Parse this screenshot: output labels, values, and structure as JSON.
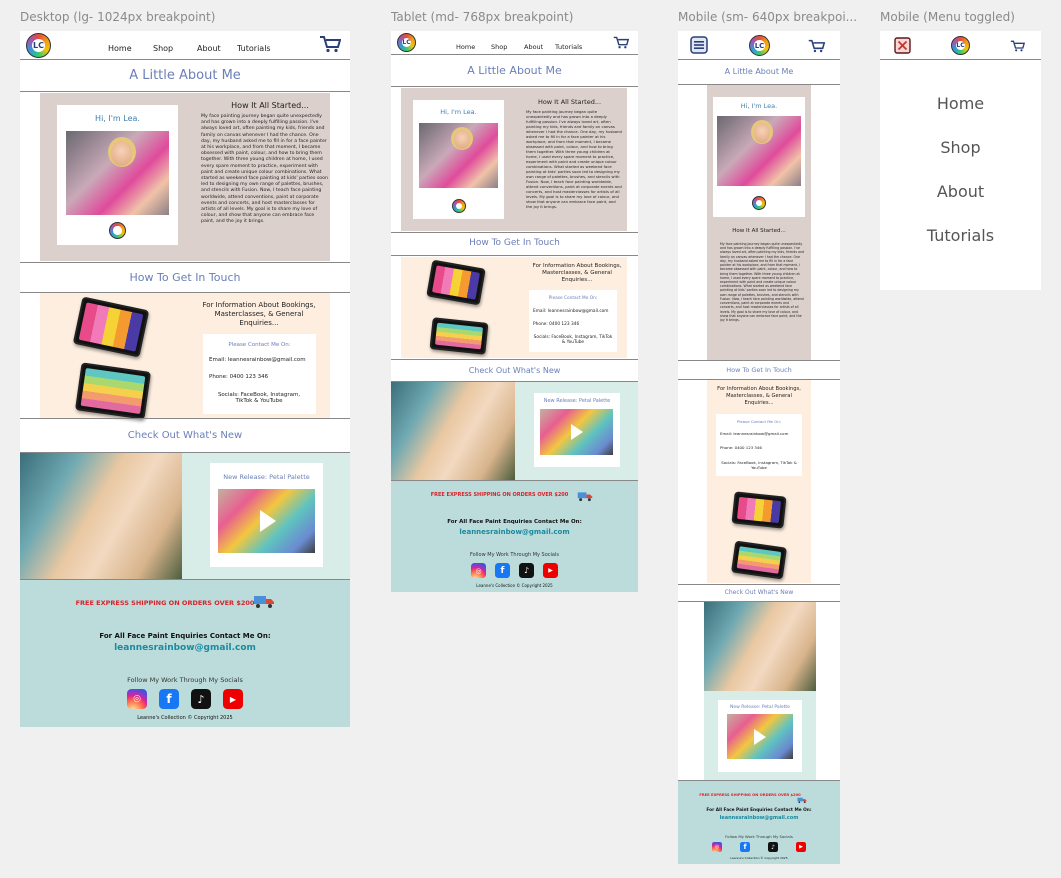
{
  "labels": {
    "desktop": "Desktop (lg- 1024px breakpoint)",
    "tablet": "Tablet (md- 768px breakpoint)",
    "mobile": "Mobile (sm- 640px breakpoi...",
    "menu": "Mobile (Menu toggled)"
  },
  "logo_text": "LC",
  "nav": {
    "home": "Home",
    "shop": "Shop",
    "about": "About",
    "tutorials": "Tutorials"
  },
  "about": {
    "title": "A Little About Me",
    "hi": "Hi, I'm Lea.",
    "story_title": "How It All Started...",
    "story": "My face painting journey began quite unexpectedly and has grown into a deeply fulfilling passion. I've always loved art, often painting my kids, friends and family on canvas whenever I had the chance. One day, my husband asked me to fill in for a face painter at his workplace, and from that moment, I became obsessed with paint, colour, and how to bring them together. With three young children at home, I used every spare moment to practice, experiment with paint and create unique colour combinations. What started as weekend face painting at kids' parties soon led to designing my own range of palettes, brushes, and stencils with Fusion. Now, I teach face painting worldwide, attend conventions, paint at corporate events and concerts, and host masterclasses for artists of all levels. My goal is to share my love of colour, and show that anyone can embrace face paint, and the joy it brings."
  },
  "contact": {
    "title": "How To Get In Touch",
    "heading": "For Information About Bookings, Masterclasses, & General Enquiries...",
    "please": "Please Contact Me On:",
    "email": "Email: leannesrainbow@gmail.com",
    "phone": "Phone: 0400 123 346",
    "socials": "Socials: FaceBook, Instagram, TikTok & YouTube"
  },
  "news": {
    "title": "Check Out What's New",
    "release": "New Release: Petal Palette"
  },
  "footer": {
    "shipping": "FREE EXPRESS SHIPPING ON ORDERS OVER $200",
    "enquiries": "For All Face Paint Enquiries Contact Me On:",
    "email": "leannesrainbow@gmail.com",
    "follow": "Follow My Work Through My Socials",
    "copyright": "Leanne's Collection © Copyright 2025"
  },
  "icons": [
    "cart-icon",
    "hamburger-menu-icon",
    "close-icon",
    "play-icon",
    "truck-icon",
    "instagram-icon",
    "facebook-icon",
    "tiktok-icon",
    "youtube-icon"
  ],
  "colors": {
    "title_blue": "#6b7fb8",
    "about_bg": "#dcd0cc",
    "contact_bg": "#fdeee0",
    "news_bg": "#d8ece8",
    "footer_bg": "#bcdcdc",
    "shipping_red": "#d8232a",
    "email_teal": "#1a8a9e"
  }
}
